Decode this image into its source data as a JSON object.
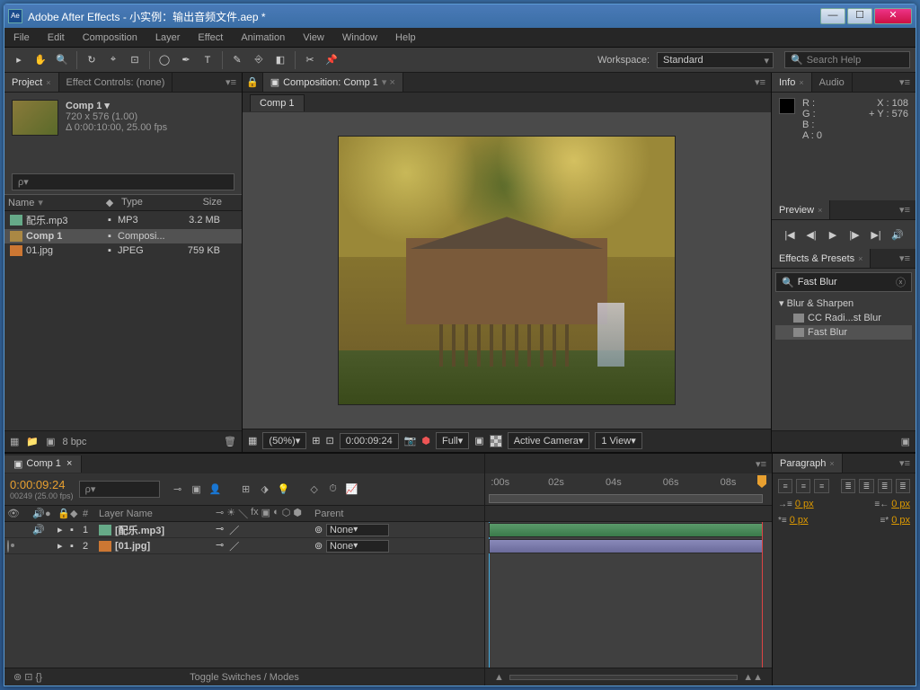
{
  "title": "Adobe After Effects - 小实例：输出音频文件.aep *",
  "menu": [
    "File",
    "Edit",
    "Composition",
    "Layer",
    "Effect",
    "Animation",
    "View",
    "Window",
    "Help"
  ],
  "workspace": {
    "label": "Workspace:",
    "value": "Standard"
  },
  "search_help": "Search Help",
  "project": {
    "tab1": "Project",
    "tab2": "Effect Controls: (none)",
    "comp_name": "Comp 1 ▾",
    "comp_dim": "720 x 576 (1.00)",
    "comp_dur": "Δ 0:00:10:00, 25.00 fps",
    "search_ph": "ρ▾",
    "cols": {
      "name": "Name",
      "type": "Type",
      "size": "Size"
    },
    "rows": [
      {
        "icon": "mp3",
        "name": "配乐.mp3",
        "type": "MP3",
        "size": "3.2 MB"
      },
      {
        "icon": "comp",
        "name": "Comp 1",
        "type": "Composi...",
        "size": ""
      },
      {
        "icon": "jpg",
        "name": "01.jpg",
        "type": "JPEG",
        "size": "759 KB"
      }
    ],
    "bpc": "8 bpc"
  },
  "comp_panel": {
    "tab": "Composition: Comp 1",
    "inner_tab": "Comp 1",
    "zoom": "(50%)",
    "time": "0:00:09:24",
    "res": "Full",
    "camera": "Active Camera",
    "views": "1 View"
  },
  "info": {
    "tab1": "Info",
    "tab2": "Audio",
    "r": "R :",
    "g": "G :",
    "b": "B :",
    "a": "A :  0",
    "x": "X : 108",
    "y": "Y : 576"
  },
  "preview": {
    "tab": "Preview"
  },
  "effects": {
    "tab": "Effects & Presets",
    "search": "Fast Blur",
    "cat": "▾ Blur & Sharpen",
    "item1": "CC Radi...st Blur",
    "item2": "Fast Blur"
  },
  "paragraph": {
    "tab": "Paragraph",
    "indent_left": "0 px",
    "indent_right": "0 px",
    "first_line": "0 px",
    "last": "0 px"
  },
  "timeline": {
    "tab": "Comp 1",
    "time": "0:00:09:24",
    "sub": "00249 (25.00 fps)",
    "search": "ρ▾",
    "col_num": "#",
    "col_layer": "Layer Name",
    "col_parent": "Parent",
    "none": "None",
    "rows": [
      {
        "n": "1",
        "name": "[配乐.mp3]",
        "icon": "mp3"
      },
      {
        "n": "2",
        "name": "[01.jpg]",
        "icon": "jpg"
      }
    ],
    "toggle": "Toggle Switches / Modes",
    "ticks": [
      ":00s",
      "02s",
      "04s",
      "06s",
      "08s"
    ]
  }
}
